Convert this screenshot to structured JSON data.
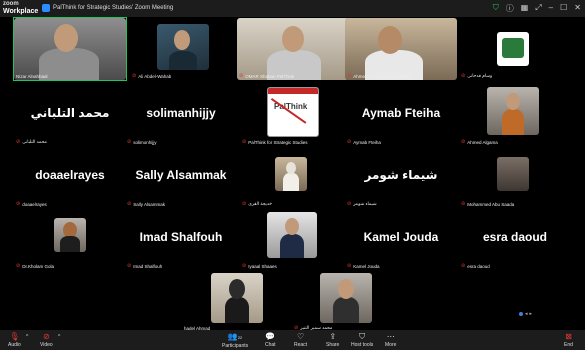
{
  "app": {
    "brand_top": "zoom",
    "brand_bottom": "Workplace",
    "window_title": "PalThink for Strategic Studies' Zoom Meeting"
  },
  "tiles": [
    {
      "label": "Nizar Alnahhaal",
      "big": ""
    },
    {
      "label": "Ali Abdel-Wahab",
      "big": ""
    },
    {
      "label": "OMAR Shaban PalThink",
      "big": ""
    },
    {
      "label": "Ahmed-El Barra (PALWAVE)",
      "big": ""
    },
    {
      "label": "وسام قدحانى",
      "big": ""
    },
    {
      "label": "محمد التلبانى",
      "big": "محمد التلباني"
    },
    {
      "label": "solimonhijjy",
      "big": "solimanhijjy"
    },
    {
      "label": "PalThink for Strategic Studies",
      "big": ""
    },
    {
      "label": "Aymab Fteiha",
      "big": "Aymab Fteiha"
    },
    {
      "label": "Ahmed Algama",
      "big": ""
    },
    {
      "label": "doaaelrayes",
      "big": "doaaelrayes"
    },
    {
      "label": "Sally Alsammak",
      "big": "Sally Alsammak"
    },
    {
      "label": "خديجة القرى",
      "big": ""
    },
    {
      "label": "شيماء شومر",
      "big": "شيماء شومر"
    },
    {
      "label": "Mohammed Abu Saada",
      "big": ""
    },
    {
      "label": "Dr.Kholam Gola",
      "big": ""
    },
    {
      "label": "Imad Shalfouh",
      "big": "Imad Shalfouh"
    },
    {
      "label": "Iyaaal Shaaes",
      "big": ""
    },
    {
      "label": "Kamel Jouda",
      "big": "Kamel Jouda"
    },
    {
      "label": "esra daoud",
      "big": "esra daoud"
    },
    {
      "label": "hadel Ahmad",
      "big": ""
    },
    {
      "label": "محمد سمير التنير",
      "big": ""
    }
  ],
  "toolbar": {
    "audio": "Audio",
    "video": "Video",
    "participants": "Participants",
    "participants_count": "22",
    "chat": "Chat",
    "react": "React",
    "share": "Share",
    "host_tools": "Host tools",
    "more": "More",
    "end": "End"
  },
  "colors": {
    "bg": "#000000",
    "bar": "#1c1c1c",
    "muted": "#e53935",
    "active": "#21c55d"
  }
}
